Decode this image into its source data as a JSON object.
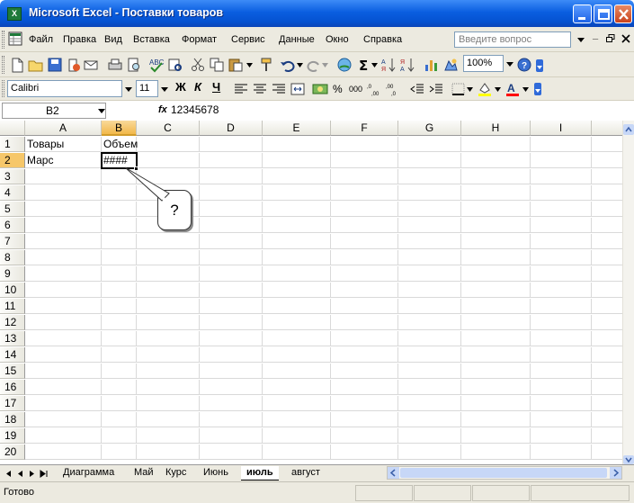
{
  "window": {
    "title": "Microsoft Excel - Поставки товаров",
    "app_icon": "X"
  },
  "menu": {
    "items": [
      "Файл",
      "Правка",
      "Вид",
      "Вставка",
      "Формат",
      "Сервис",
      "Данные",
      "Окно",
      "Справка"
    ],
    "help_placeholder": "Введите вопрос"
  },
  "toolbar": {
    "zoom": "100%",
    "icons": [
      "new-icon",
      "open-icon",
      "save-icon",
      "permission-icon",
      "print-icon",
      "print-preview-icon",
      "spelling-icon",
      "research-icon",
      "cut-icon",
      "copy-icon",
      "paste-icon",
      "format-painter-icon",
      "undo-icon",
      "redo-icon",
      "hyperlink-icon",
      "autosum-icon",
      "sort-asc-icon",
      "sort-desc-icon",
      "chart-icon",
      "drawing-icon",
      "help-icon"
    ]
  },
  "format": {
    "font": "Calibri",
    "size": "11",
    "bold": "Ж",
    "italic": "К",
    "underline": "Ч"
  },
  "formula_bar": {
    "name_box": "B2",
    "fx": "fx",
    "value": "12345678"
  },
  "grid": {
    "columns": [
      "A",
      "B",
      "C",
      "D",
      "E",
      "F",
      "G",
      "H",
      "I"
    ],
    "rows": [
      "1",
      "2",
      "3",
      "4",
      "5",
      "6",
      "7",
      "8",
      "9",
      "10",
      "11",
      "12",
      "13",
      "14",
      "15",
      "16",
      "17",
      "18",
      "19",
      "20"
    ],
    "selected_column": "B",
    "selected_row": "2",
    "cells": {
      "A1": "Товары",
      "B1": "Объем",
      "A2": "Марс",
      "B2": "####"
    }
  },
  "callout": {
    "text": "?"
  },
  "sheet_tabs": [
    "Диаграмма",
    "Май",
    "Курс",
    "Июнь",
    "июль",
    "август"
  ],
  "active_tab": "июль",
  "status": {
    "text": "Готово"
  },
  "colors": {
    "title_blue": "#0a5ee0",
    "chrome": "#eceae0",
    "selected_header": "#f6c76a"
  }
}
